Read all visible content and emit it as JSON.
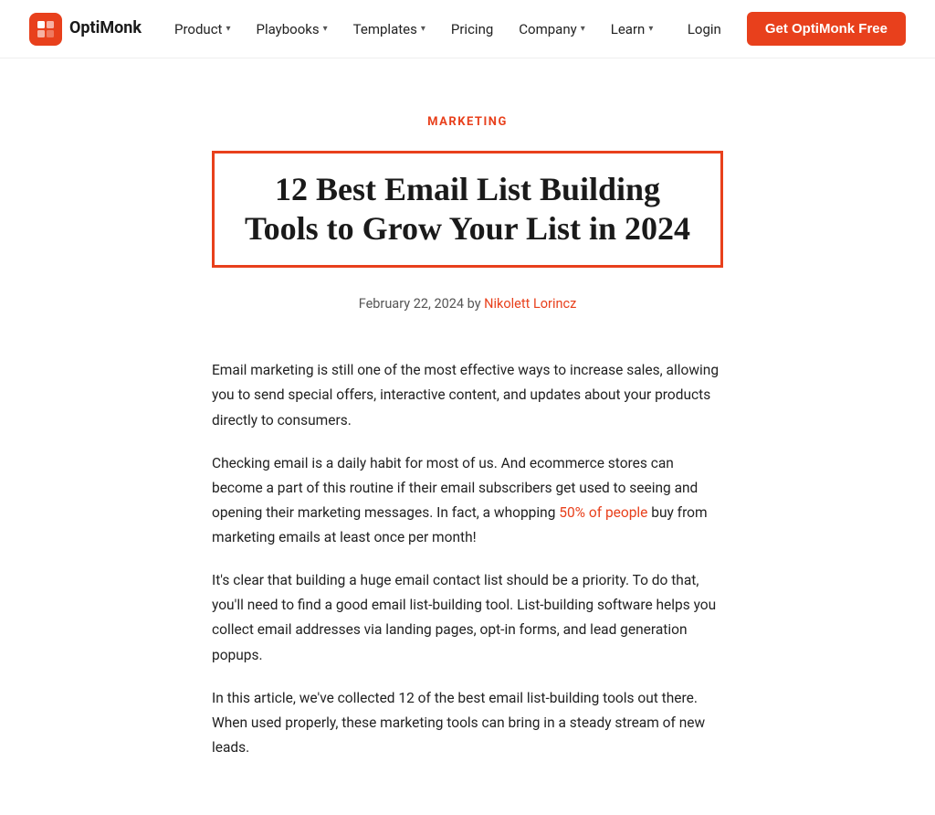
{
  "brand": {
    "name": "OptiMonk",
    "logo_alt": "OptiMonk logo"
  },
  "navbar": {
    "items": [
      {
        "label": "Product",
        "has_dropdown": true
      },
      {
        "label": "Playbooks",
        "has_dropdown": true
      },
      {
        "label": "Templates",
        "has_dropdown": true
      },
      {
        "label": "Pricing",
        "has_dropdown": false
      },
      {
        "label": "Company",
        "has_dropdown": true
      },
      {
        "label": "Learn",
        "has_dropdown": true
      }
    ],
    "login_label": "Login",
    "cta_label": "Get OptiMonk Free"
  },
  "article": {
    "category": "MARKETING",
    "title": "12 Best Email List Building Tools to Grow Your List in 2024",
    "meta": "February 22, 2024 by",
    "author": "Nikolett Lorincz",
    "paragraphs": [
      "Email marketing is still one of the most effective ways to increase sales, allowing you to send special offers, interactive content, and updates about your products directly to consumers.",
      "Checking email is a daily habit for most of us. And ecommerce stores can become a part of this routine if their email subscribers get used to seeing and opening their marketing messages. In fact, a whopping 50% of people buy from marketing emails at least once per month!",
      "It's clear that building a huge email contact list should be a priority. To do that, you'll need to find a good email list-building tool. List-building software helps you collect email addresses via landing pages, opt-in forms, and lead generation popups.",
      "In this article, we've collected 12 of the best email list-building tools out there. When used properly, these marketing tools can bring in a steady stream of new leads."
    ],
    "inline_link_text": "50% of people",
    "inline_link_url": "#"
  }
}
